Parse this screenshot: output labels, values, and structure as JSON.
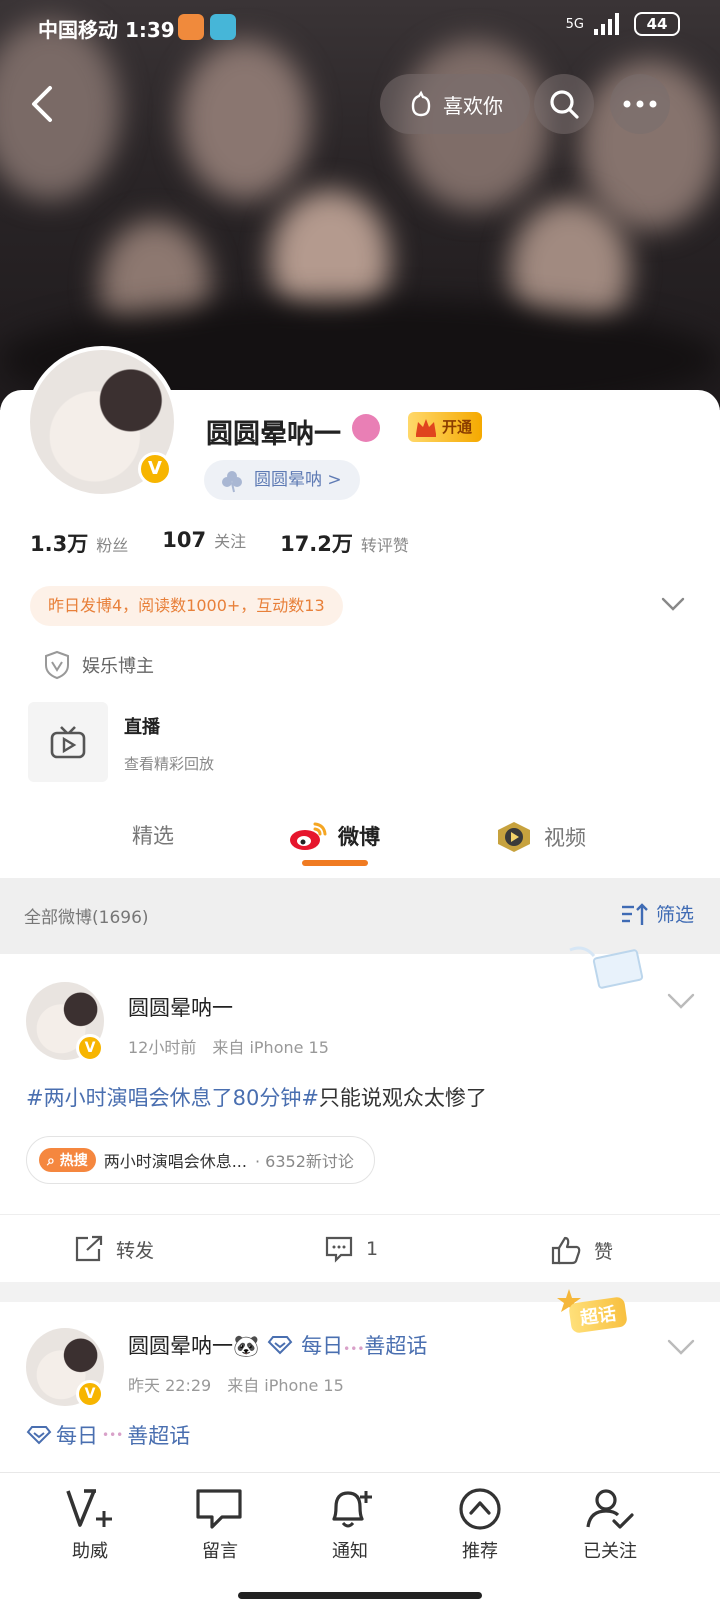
{
  "status_bar": {
    "carrier_time": "中国移动 1:39",
    "network": "5G",
    "battery": "44"
  },
  "header": {
    "like_label": "喜欢你"
  },
  "profile": {
    "name": "圆圆晕呐一",
    "vip_label": "开通",
    "nickname_pill": "圆圆晕呐 >",
    "stats": [
      {
        "value": "1.3万",
        "label": "粉丝"
      },
      {
        "value": "107",
        "label": "关注"
      },
      {
        "value": "17.2万",
        "label": "转评赞"
      }
    ],
    "summary": "昨日发博4，阅读数1000+，互动数13",
    "role": "娱乐博主",
    "live": {
      "title": "直播",
      "subtitle": "查看精彩回放"
    }
  },
  "tabs": [
    {
      "label": "精选"
    },
    {
      "label": "微博"
    },
    {
      "label": "视频"
    }
  ],
  "filter_bar": {
    "label": "全部微博(1696)",
    "filter_label": "筛选"
  },
  "posts": [
    {
      "author": "圆圆晕呐一",
      "time": "12小时前",
      "source": "来自 iPhone 15",
      "tag": "#两小时演唱会休息了80分钟#",
      "text": "只能说观众太惨了",
      "hot_label": "热搜",
      "hot_topic": "两小时演唱会休息...",
      "hot_count": "· 6352新讨论",
      "actions": {
        "repost": "转发",
        "comment": "1",
        "like": "赞"
      }
    },
    {
      "author": "圆圆晕呐一🐼",
      "super_label": "每日",
      "super_suffix": "善超话",
      "badge_text": "超话",
      "time": "昨天 22:29",
      "source": "来自 iPhone 15",
      "body_prefix": "每日",
      "body_suffix": "善超话"
    }
  ],
  "bottom_nav": [
    {
      "label": "助威",
      "icon": "cheer-icon"
    },
    {
      "label": "留言",
      "icon": "message-icon"
    },
    {
      "label": "通知",
      "icon": "bell-icon"
    },
    {
      "label": "推荐",
      "icon": "recommend-icon"
    },
    {
      "label": "已关注",
      "icon": "followed-icon"
    }
  ],
  "colors": {
    "accent": "#f07b22",
    "link": "#4a6fb0",
    "vip": "#f7b500"
  }
}
